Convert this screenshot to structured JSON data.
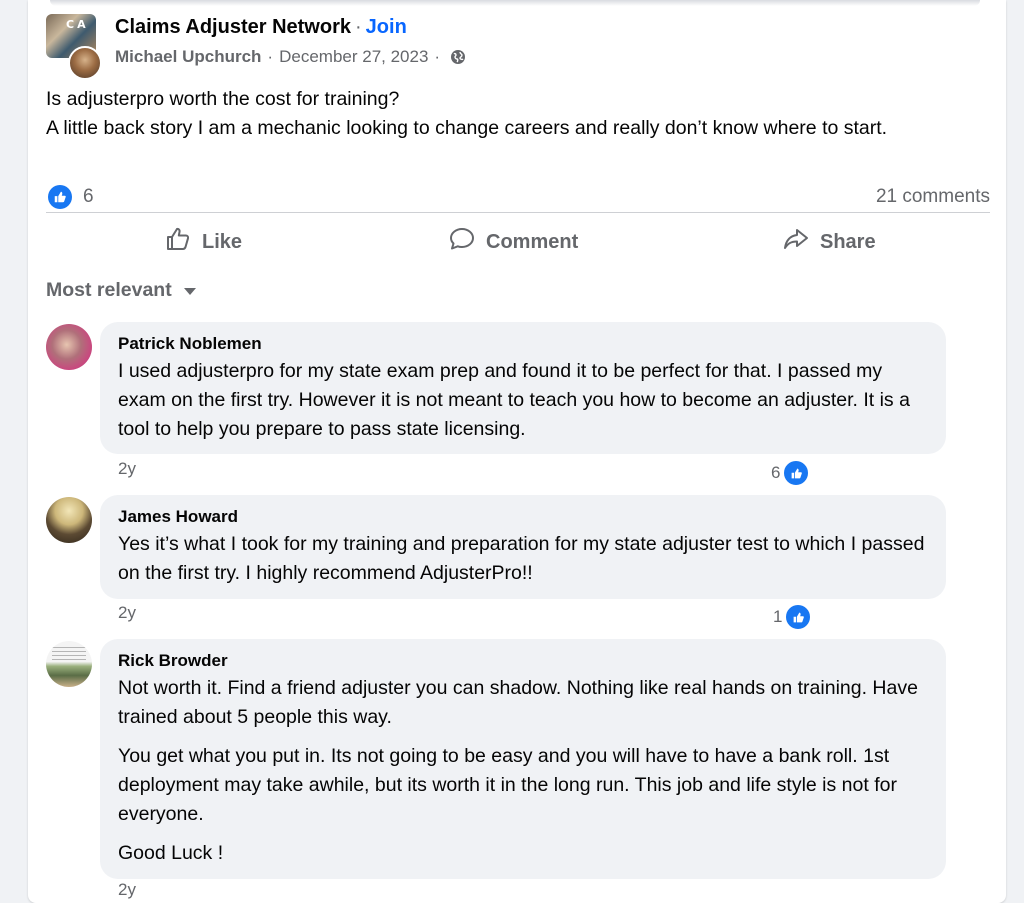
{
  "post": {
    "group_name": "Claims Adjuster Network",
    "separator": "·",
    "join_label": "Join",
    "author": "Michael Upchurch",
    "date": "December 27, 2023",
    "date_sep_1": "·",
    "date_sep_2": "·",
    "privacy_icon": "globe-icon",
    "group_logo_text": "CA",
    "text_line_1": "Is adjusterpro worth the cost for training?",
    "text_line_2": "A little back story I am a mechanic looking to change careers and really don’t know where to start.",
    "reaction_count": "6",
    "comments_count": "21 comments"
  },
  "actions": {
    "like_label": "Like",
    "comment_label": "Comment",
    "share_label": "Share"
  },
  "sort": {
    "label": "Most relevant"
  },
  "comments": [
    {
      "name": "Patrick Noblemen",
      "paragraphs": [
        "I used adjusterpro for my state exam prep and found it to be perfect for that. I passed my exam on the first try. However it is not meant to teach you how to become an adjuster. It is a tool to help you prepare to pass state licensing."
      ],
      "time": "2y",
      "reactions": "6"
    },
    {
      "name": "James Howard",
      "paragraphs": [
        "Yes it’s what I took for my training and preparation for my state adjuster test to which I passed on the first try. I highly recommend AdjusterPro!!"
      ],
      "time": "2y",
      "reactions": "1"
    },
    {
      "name": "Rick Browder",
      "paragraphs": [
        "Not worth it. Find a friend adjuster you can shadow. Nothing like real hands on training. Have trained about 5 people this way.",
        "You get what you put in. Its not going to be easy and you will have to have a bank roll. 1st deployment may take awhile, but its worth it in the long run. This job and life style is not for everyone.",
        "Good Luck !"
      ],
      "time": "2y"
    }
  ],
  "colors": {
    "accent": "#0866ff",
    "like_blue": "#1877f2",
    "secondary_text": "#65676b",
    "bubble_bg": "#f0f2f5"
  }
}
